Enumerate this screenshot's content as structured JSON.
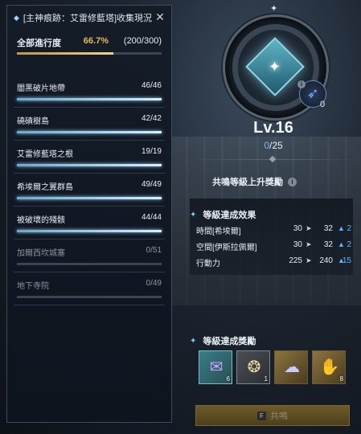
{
  "panel": {
    "title": "[主神痕跡：艾雷修藍塔]收集現況",
    "overall": {
      "label": "全部進行度",
      "percent_text": "66.7%",
      "count_text": "(200/300)",
      "progress": 0.667
    },
    "items": [
      {
        "name": "闇黑破片地帶",
        "count": "46/46",
        "progress": 1.0,
        "active": true
      },
      {
        "name": "磽磧樹島",
        "count": "42/42",
        "progress": 1.0,
        "active": true
      },
      {
        "name": "艾雷修藍塔之根",
        "count": "19/19",
        "progress": 1.0,
        "active": true
      },
      {
        "name": "希埃爾之翼群島",
        "count": "49/49",
        "progress": 1.0,
        "active": true
      },
      {
        "name": "被破壞的殘骸",
        "count": "44/44",
        "progress": 1.0,
        "active": true
      },
      {
        "name": "加爾西坎城塞",
        "count": "0/51",
        "progress": 0.0,
        "active": false
      },
      {
        "name": "地下寺院",
        "count": "0/49",
        "progress": 0.0,
        "active": false
      }
    ]
  },
  "resonance": {
    "level": "Lv.16",
    "current": "0",
    "total": "/25",
    "feather_count": "0",
    "reward_title": "共鳴等級上升獎勵"
  },
  "effects": {
    "title": "等級達成效果",
    "rows": [
      {
        "name": "時間[希埃爾]",
        "from": "30",
        "to": "32",
        "diff": "2"
      },
      {
        "name": "空間[伊斯拉佩爾]",
        "from": "30",
        "to": "32",
        "diff": "2"
      },
      {
        "name": "行動力",
        "from": "225",
        "to": "240",
        "diff": "15"
      }
    ]
  },
  "rewards": {
    "title": "等級達成獎勵",
    "slots": [
      {
        "icon": "scroll-icon",
        "qty": "6"
      },
      {
        "icon": "coin-pouch-icon",
        "qty": "1"
      },
      {
        "icon": "cloth-icon",
        "qty": ""
      },
      {
        "icon": "gauntlet-icon",
        "qty": "8"
      }
    ]
  },
  "button": {
    "key": "F",
    "label": "共鳴"
  },
  "colors": {
    "accent": "#6fb6ff",
    "gold": "#e4b860",
    "bar": "#d6f0ff"
  }
}
